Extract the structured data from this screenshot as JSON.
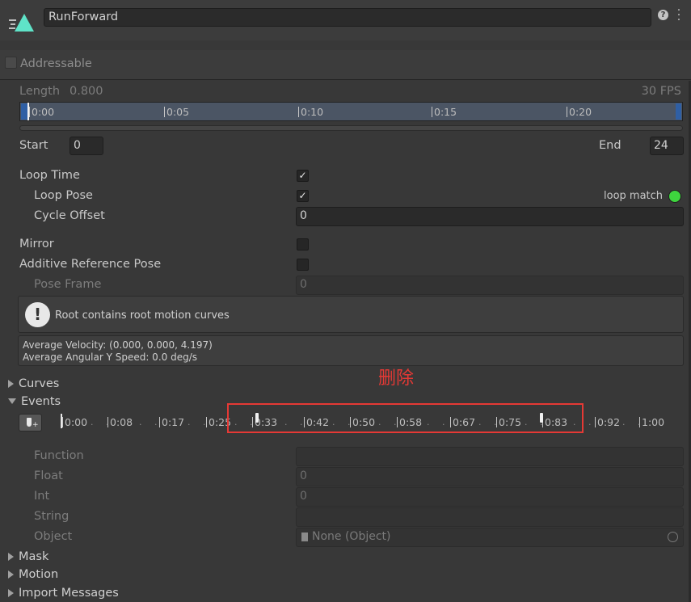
{
  "header": {
    "clip_name": "RunForward",
    "help_icon": "help-icon",
    "menu_icon": "kebab-menu-icon"
  },
  "addressable": {
    "label": "Addressable",
    "checked": false
  },
  "timeline": {
    "length_label": "Length",
    "length_value": "0.800",
    "fps": "30 FPS",
    "ticks": [
      "0:00",
      "0:05",
      "0:10",
      "0:15",
      "0:20"
    ]
  },
  "range": {
    "start_label": "Start",
    "start_value": "0",
    "end_label": "End",
    "end_value": "24"
  },
  "settings": {
    "loop_time_label": "Loop Time",
    "loop_time_checked": true,
    "loop_pose_label": "Loop Pose",
    "loop_pose_checked": true,
    "loop_match_label": "loop match",
    "loop_match_color": "#3ed43e",
    "cycle_offset_label": "Cycle Offset",
    "cycle_offset_value": "0",
    "mirror_label": "Mirror",
    "mirror_checked": false,
    "additive_label": "Additive Reference Pose",
    "additive_checked": false,
    "pose_frame_label": "Pose Frame",
    "pose_frame_value": "0"
  },
  "info": {
    "message": "Root contains root motion curves",
    "velocity": "Average Velocity: (0.000, 0.000, 4.197)",
    "angular": "Average Angular Y Speed: 0.0 deg/s"
  },
  "annotation": {
    "text": "删除",
    "color": "#e53935"
  },
  "sections": {
    "curves": "Curves",
    "events": "Events",
    "mask": "Mask",
    "motion": "Motion",
    "import_messages": "Import Messages"
  },
  "events_ruler": {
    "ticks": [
      "0:00",
      "0:08",
      "0:17",
      "0:25",
      "0:33",
      "0:42",
      "0:50",
      "0:58",
      "0:67",
      "0:75",
      "0:83",
      "0:92",
      "1:00"
    ]
  },
  "event_fields": {
    "function_label": "Function",
    "function_value": "",
    "float_label": "Float",
    "float_value": "0",
    "int_label": "Int",
    "int_value": "0",
    "string_label": "String",
    "string_value": "",
    "object_label": "Object",
    "object_value": "None (Object)"
  }
}
